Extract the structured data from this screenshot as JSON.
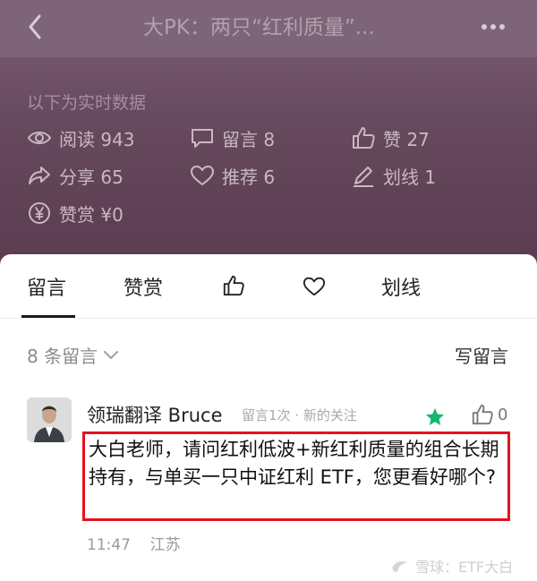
{
  "header": {
    "title": "大PK：两只“红利质量”...",
    "back_icon": "chevron-left-icon",
    "more_icon": "more-dots-icon"
  },
  "stats": {
    "caption": "以下为实时数据",
    "items": [
      {
        "icon": "eye-icon",
        "label": "阅读 943"
      },
      {
        "icon": "comment-icon",
        "label": "留言 8"
      },
      {
        "icon": "thumb-up-icon",
        "label": "赞 27"
      },
      {
        "icon": "share-icon",
        "label": "分享 65"
      },
      {
        "icon": "heart-icon",
        "label": "推荐 6"
      },
      {
        "icon": "pen-icon",
        "label": "划线 1"
      },
      {
        "icon": "yen-icon",
        "label": "赞赏 ¥0"
      }
    ]
  },
  "tabs": [
    {
      "label": "留言",
      "active": true
    },
    {
      "label": "赞赏"
    },
    {
      "icon": "thumb-up-icon"
    },
    {
      "icon": "heart-icon"
    },
    {
      "label": "划线"
    }
  ],
  "comments_header": {
    "count_label": "8 条留言",
    "write_label": "写留言"
  },
  "comment": {
    "author": "领瑞翻译 Bruce",
    "meta": "留言1次 · 新的关注",
    "likes": "0",
    "text": "大白老师，请问红利低波+新红利质量的组合长期持有，与单买一只中证红利 ETF，您更看好哪个?",
    "time": "11:47",
    "location": "江苏"
  },
  "watermark": "雪球：ETF大白",
  "colors": {
    "highlight_border": "#e3121e",
    "star": "#12b76a",
    "overlay_bg": "#5e3f53"
  }
}
